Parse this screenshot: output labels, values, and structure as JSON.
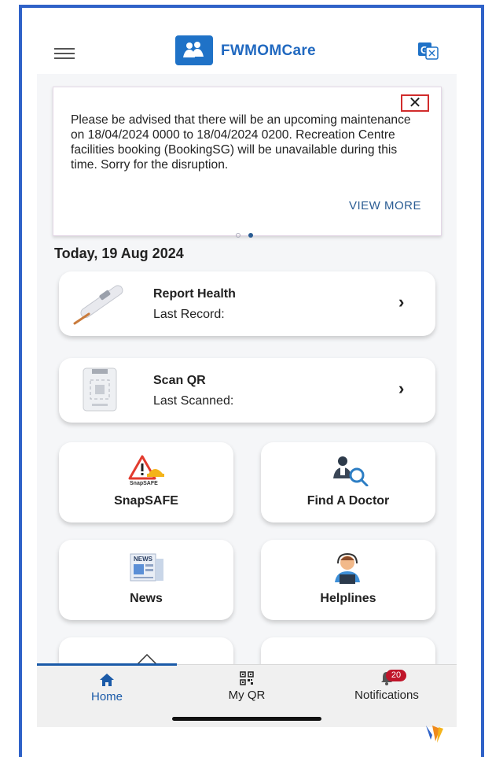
{
  "header": {
    "app_title": "FWMOMCare",
    "menu_icon": "hamburger-menu-icon",
    "translate_icon": "translate-icon",
    "brand_color": "#1f72c7"
  },
  "banner": {
    "message": "Please be advised that there will be an upcoming maintenance on 18/04/2024 0000 to 18/04/2024 0200. Recreation Centre facilities booking (BookingSG) will be unavailable during this time. Sorry for the disruption.",
    "close_label": "✕",
    "view_more_label": "VIEW MORE",
    "page_count": 2,
    "active_page": 2
  },
  "date_heading": "Today, 19 Aug 2024",
  "cards": {
    "report_health": {
      "title": "Report Health",
      "subtitle": "Last Record:",
      "chevron": "›",
      "icon": "thermometer-icon"
    },
    "scan_qr": {
      "title": "Scan QR",
      "subtitle": "Last Scanned:",
      "chevron": "›",
      "icon": "qr-scanner-icon"
    }
  },
  "tiles": [
    {
      "label": "SnapSAFE",
      "icon": "snapsafe-icon",
      "icon_caption": "SnapSAFE"
    },
    {
      "label": "Find A Doctor",
      "icon": "doctor-search-icon"
    },
    {
      "label": "News",
      "icon": "news-icon",
      "icon_caption": "NEWS"
    },
    {
      "label": "Helplines",
      "icon": "helpline-agent-icon"
    }
  ],
  "bottom_nav": {
    "items": [
      {
        "label": "Home",
        "icon": "home-icon",
        "active": true
      },
      {
        "label": "My QR",
        "icon": "qr-code-icon",
        "active": false
      },
      {
        "label": "Notifications",
        "icon": "bell-icon",
        "active": false
      }
    ],
    "notification_count": "20",
    "active_color": "#1a5aa8"
  }
}
